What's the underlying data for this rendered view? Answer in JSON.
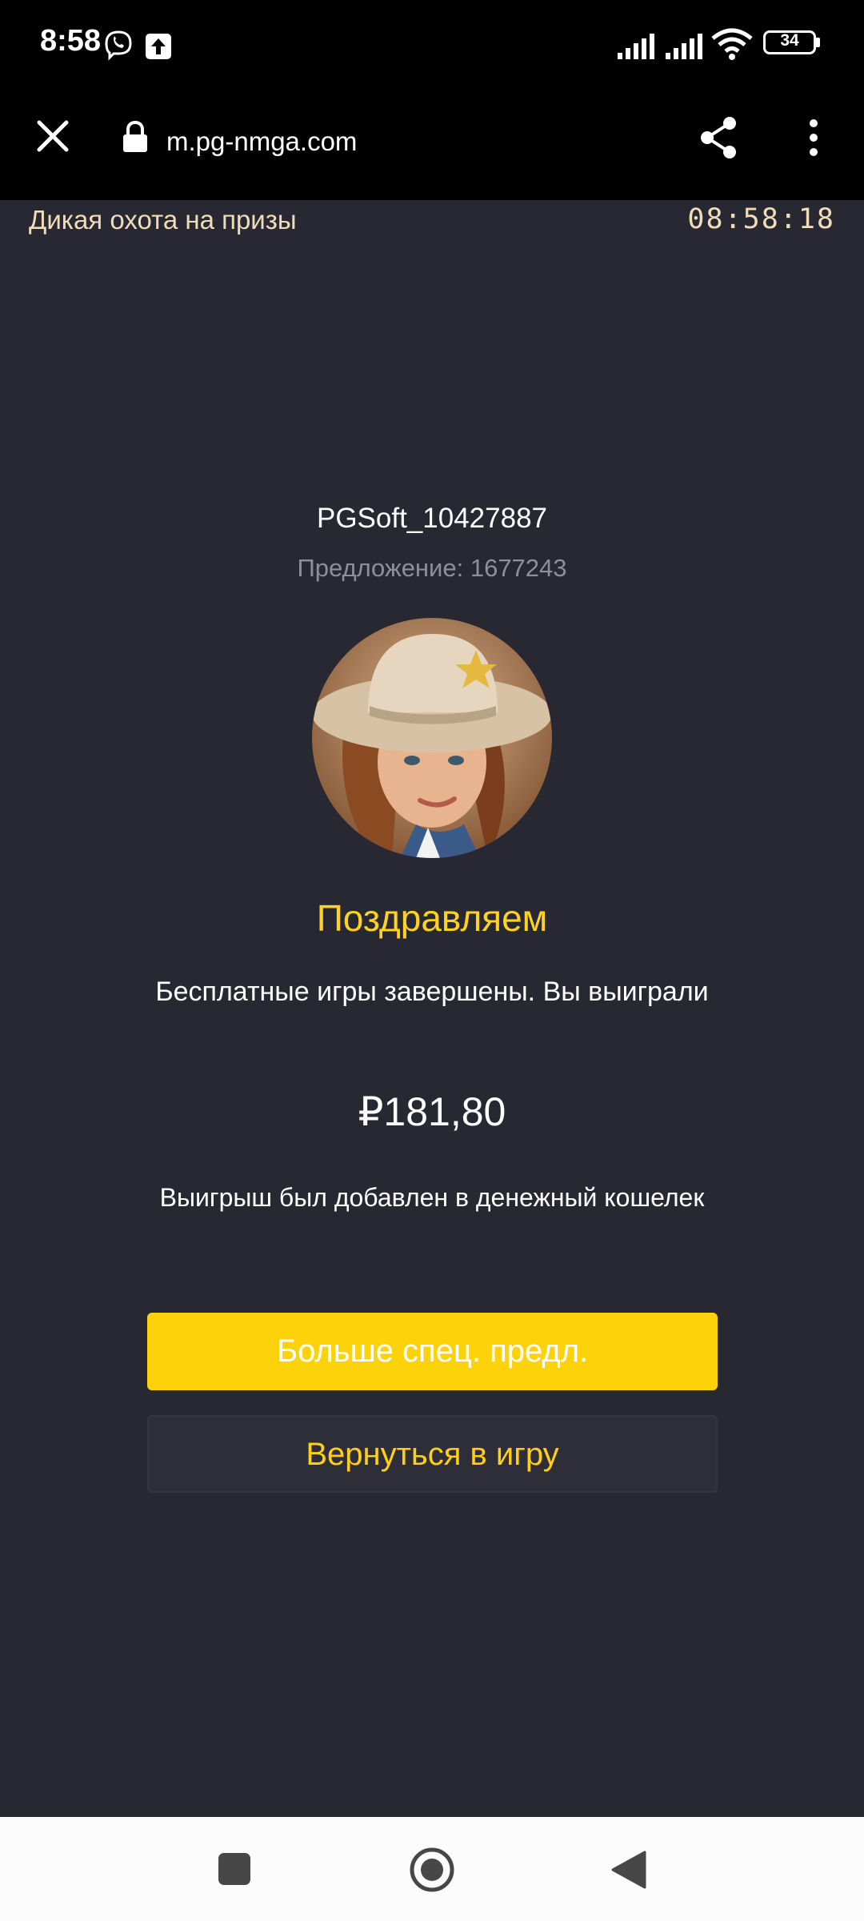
{
  "status_bar": {
    "time": "8:58",
    "battery": "34"
  },
  "browser": {
    "url": "m.pg-nmga.com"
  },
  "header": {
    "title": "Дикая охота на призы",
    "clock": "08:58:18"
  },
  "offer": {
    "user_id": "PGSoft_10427887",
    "offer_line": "Предложение: 1677243",
    "congrats": "Поздравляем",
    "free_games_text": "Бесплатные игры завершены. Вы выиграли",
    "prize": "₽181,80",
    "wallet_note": "Выигрыш был добавлен в денежный кошелек",
    "more_offers_label": "Больше спец. предл.",
    "back_to_game_label": "Вернуться в игру"
  },
  "colors": {
    "background": "#282833",
    "accent_yellow": "#fcd20b",
    "header_text": "#f1dcb9",
    "muted_text": "#8f8f99"
  },
  "icons": {
    "status": [
      "viber-icon",
      "upload-icon",
      "signal-icon",
      "signal-icon",
      "wifi-icon",
      "battery-icon"
    ],
    "browser": [
      "close-icon",
      "lock-icon",
      "share-icon",
      "more-vert-icon"
    ],
    "nav": [
      "recents-square-icon",
      "home-circle-icon",
      "back-triangle-icon"
    ]
  }
}
